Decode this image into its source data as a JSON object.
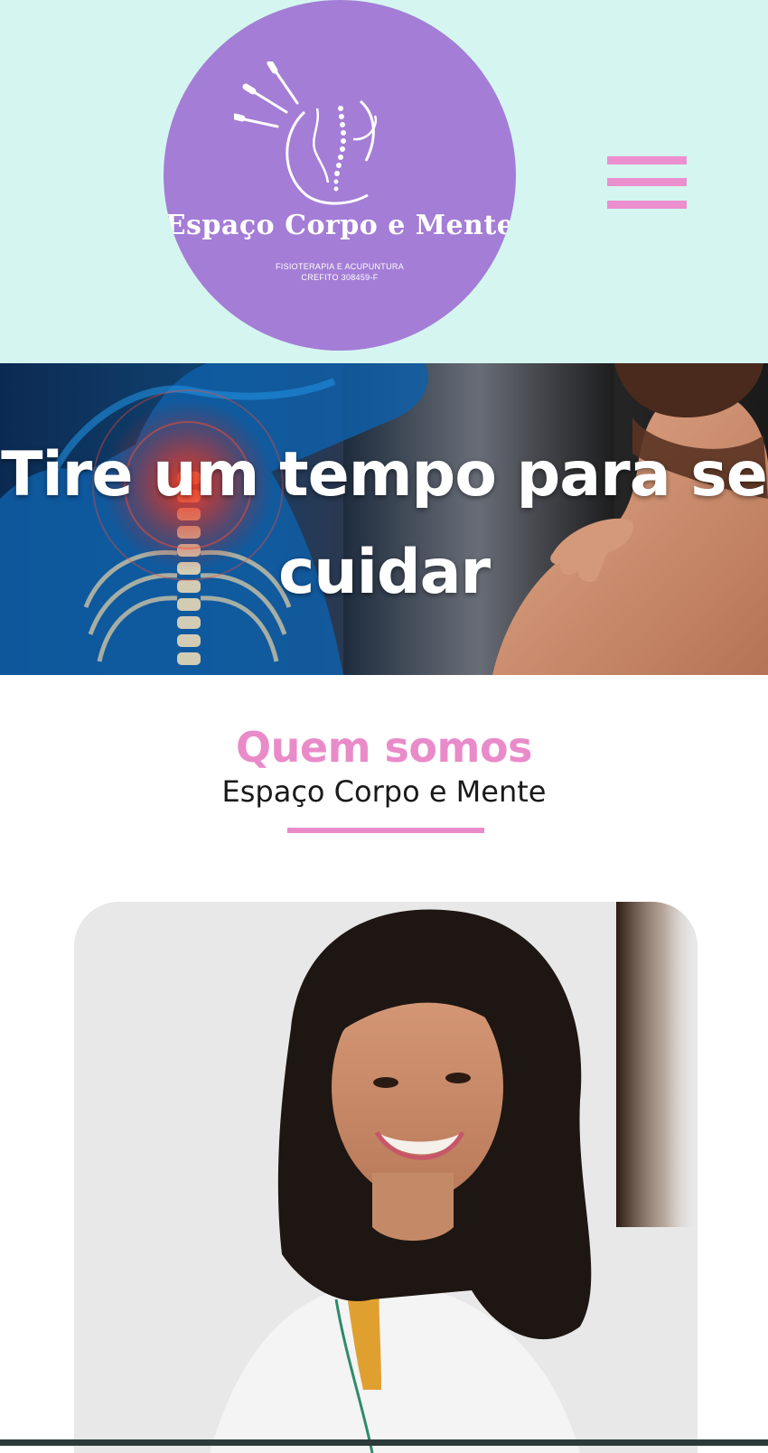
{
  "header": {
    "logo": {
      "title": "Espaço Corpo e Mente",
      "subtitle_line1": "FISIOTERAPIA E ACUPUNTURA",
      "subtitle_line2": "CREFITO 308459-F",
      "icon": "acupuncture-spine-logo-icon"
    },
    "menu_icon": "hamburger-menu-icon"
  },
  "hero": {
    "title": "Tire um tempo para se cuidar"
  },
  "about": {
    "title": "Quem somos",
    "subtitle": "Espaço Corpo e Mente"
  },
  "colors": {
    "header_bg": "#d5f6f0",
    "logo_bg": "#a47dd6",
    "accent_pink": "#e98bc9"
  }
}
